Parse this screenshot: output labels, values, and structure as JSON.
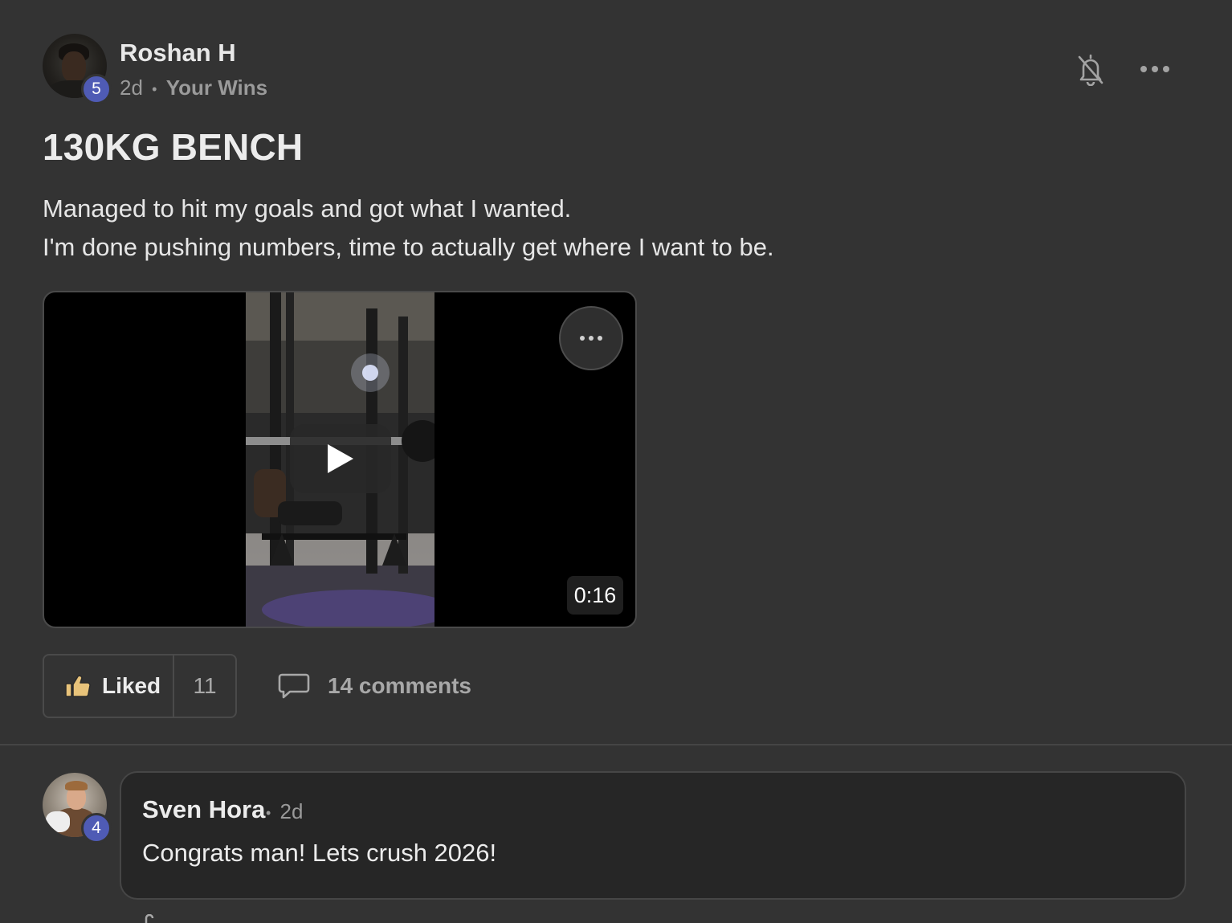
{
  "post": {
    "author": "Roshan H",
    "author_level": "5",
    "time_ago": "2d",
    "separator": "•",
    "category": "Your Wins",
    "title": "130KG BENCH",
    "body_lines": [
      "Managed to hit my goals and got what I wanted.",
      "I'm done pushing numbers, time to actually get where I want to be."
    ]
  },
  "header_actions": {
    "notifications_icon": "bell-off-icon",
    "more_icon": "more-horizontal-icon"
  },
  "video": {
    "duration": "0:16",
    "play_icon": "play-icon",
    "options_icon": "more-horizontal-icon"
  },
  "actions": {
    "like_label": "Liked",
    "like_count": "11",
    "like_icon": "thumbs-up-icon",
    "like_icon_color": "#e8c37a",
    "comments_label": "14 comments",
    "comments_icon": "comment-icon"
  },
  "comments": [
    {
      "author": "Sven Hora",
      "author_level": "4",
      "time_ago": "2d",
      "separator": "•",
      "text": "Congrats man! Lets crush 2026!"
    }
  ],
  "colors": {
    "background": "#333333",
    "badge": "#4f5bb5",
    "comment_bubble": "#262626"
  }
}
